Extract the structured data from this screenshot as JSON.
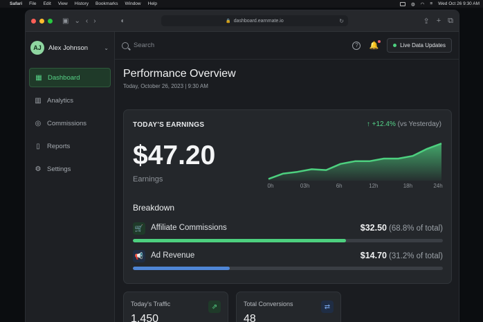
{
  "menubar": {
    "app": "Safari",
    "items": [
      "File",
      "Edit",
      "View",
      "History",
      "Bookmarks",
      "Window",
      "Help"
    ],
    "clock": "Wed Oct 26  9:30 AM"
  },
  "browser": {
    "url": "dashboard.earnmate.io"
  },
  "user": {
    "initials": "AJ",
    "name": "Alex Johnson"
  },
  "sidebar": {
    "items": [
      {
        "label": "Dashboard",
        "icon": "dashboard-icon",
        "active": true
      },
      {
        "label": "Analytics",
        "icon": "bar-chart-icon",
        "active": false
      },
      {
        "label": "Commissions",
        "icon": "coins-icon",
        "active": false
      },
      {
        "label": "Reports",
        "icon": "document-icon",
        "active": false
      },
      {
        "label": "Settings",
        "icon": "gear-icon",
        "active": false
      }
    ]
  },
  "topbar": {
    "search_placeholder": "Search",
    "live_label": "Live Data Updates"
  },
  "page": {
    "title": "Performance Overview",
    "date": "Today, October 26, 2023 | 9:30 AM"
  },
  "earnings": {
    "label": "TODAY'S EARNINGS",
    "change_arrow": "↑",
    "change": "+12.4%",
    "change_note": "(vs Yesterday)",
    "amount": "$47.20",
    "sublabel": "Earnings"
  },
  "chart_data": {
    "type": "area",
    "x_labels": [
      "0h",
      "03h",
      "6h",
      "12h",
      "18h",
      "24h"
    ],
    "x": [
      0,
      2,
      4,
      6,
      8,
      10,
      12,
      14,
      16,
      18,
      20,
      22,
      24
    ],
    "values": [
      2,
      8,
      10,
      13,
      12,
      19,
      22,
      22,
      25,
      25,
      28,
      36,
      42
    ],
    "ylim": [
      0,
      50
    ],
    "color": "#4dd07f"
  },
  "breakdown": {
    "title": "Breakdown",
    "items": [
      {
        "label": "Affiliate Commissions",
        "amount": "$32.50",
        "share": "(68.8% of total)",
        "fraction": 0.688,
        "color": "#4dd07f",
        "icon": "cart-icon"
      },
      {
        "label": "Ad Revenue",
        "amount": "$14.70",
        "share": "(31.2% of total)",
        "fraction": 0.312,
        "color": "#4f86d6",
        "icon": "megaphone-icon"
      }
    ]
  },
  "stats": [
    {
      "title": "Today's Traffic",
      "value": "1,450",
      "icon": "traffic-icon",
      "color": "#4dd07f"
    },
    {
      "title": "Total Conversions",
      "value": "48",
      "icon": "conversions-icon",
      "color": "#4f86d6"
    }
  ]
}
